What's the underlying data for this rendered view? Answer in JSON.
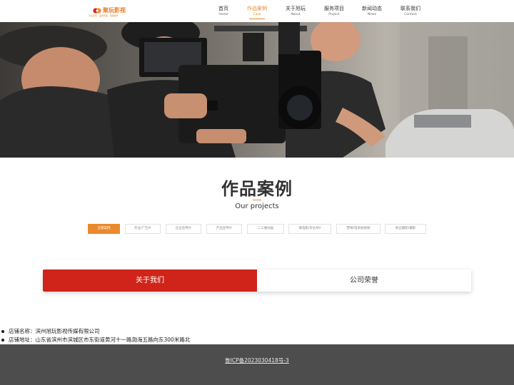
{
  "header": {
    "logo": {
      "name": "聚玩影视",
      "slogan": "专注影视 · 品牌传播 · 视频制作"
    },
    "nav": [
      {
        "zh": "首页",
        "en": "Home",
        "active": false
      },
      {
        "zh": "作品案例",
        "en": "Case",
        "active": true
      },
      {
        "zh": "关于旭玩",
        "en": "About",
        "active": false
      },
      {
        "zh": "服务项目",
        "en": "Project",
        "active": false
      },
      {
        "zh": "新闻动态",
        "en": "News",
        "active": false
      },
      {
        "zh": "联系我们",
        "en": "Contact",
        "active": false
      }
    ]
  },
  "projects": {
    "title": "作品案例",
    "subtitle": "Our projects",
    "filters": [
      {
        "label": "全部案例",
        "active": true
      },
      {
        "label": "开业/广告片",
        "active": false
      },
      {
        "label": "企业宣传片",
        "active": false
      },
      {
        "label": "产品宣传片",
        "active": false
      },
      {
        "label": "二三维动画",
        "active": false
      },
      {
        "label": "微电影/毕业MV",
        "active": false
      },
      {
        "label": "营销/电商短视频",
        "active": false
      },
      {
        "label": "商业摄影/摄影",
        "active": false
      }
    ]
  },
  "tabs": {
    "about": "关于我们",
    "honor": "公司荣誉"
  },
  "shop": {
    "name": "店铺名称：滨州旭玩影视传媒有限公司",
    "address": "店铺地址：山东省滨州市滨城区市东街道黄河十一路渤海五路向东300米路北"
  },
  "footer": {
    "icp": "鲁ICP备2023030418号-3"
  },
  "colors": {
    "accent": "#e8852b",
    "tab_active": "#d0241a",
    "footer_bg": "#4d4d4d"
  }
}
